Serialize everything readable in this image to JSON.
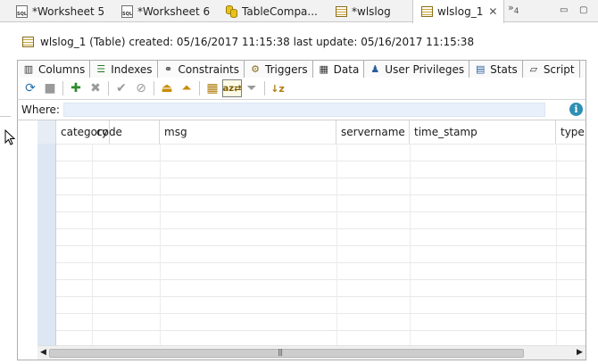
{
  "editor_tabs": [
    {
      "label": "*Worksheet 5",
      "icon": "sql-worksheet-icon"
    },
    {
      "label": "*Worksheet 6",
      "icon": "sql-worksheet-icon"
    },
    {
      "label": "TableCompa...",
      "icon": "table-compare-icon"
    },
    {
      "label": "*wlslog",
      "icon": "table-icon"
    },
    {
      "label": "wlslog_1",
      "icon": "table-icon",
      "active": true
    }
  ],
  "overflow_count": "4",
  "title": "wlslog_1 (Table) created: 05/16/2017 11:15:38 last update: 05/16/2017 11:15:38",
  "sub_tabs": [
    {
      "label": "Columns",
      "icon": "columns-icon"
    },
    {
      "label": "Indexes",
      "icon": "indexes-icon"
    },
    {
      "label": "Constraints",
      "icon": "constraints-icon"
    },
    {
      "label": "Triggers",
      "icon": "triggers-icon"
    },
    {
      "label": "Data",
      "icon": "data-grid-icon",
      "active": true
    },
    {
      "label": "User Privileges",
      "icon": "user-privileges-icon"
    },
    {
      "label": "Stats",
      "icon": "stats-icon"
    },
    {
      "label": "Script",
      "icon": "script-icon"
    }
  ],
  "toolbar": [
    "refresh-icon",
    "stop-icon",
    "add-row-icon",
    "delete-row-icon",
    "commit-icon",
    "rollback-icon",
    "export-icon",
    "import-icon",
    "grid-layout-icon",
    "sort-icon",
    "filter-icon",
    "sort-descending-icon"
  ],
  "where": {
    "label": "Where:",
    "value": ""
  },
  "grid": {
    "columns": [
      "category",
      "code",
      "msg",
      "servername",
      "time_stamp",
      "type"
    ],
    "rows": []
  },
  "colors": {
    "accent": "#2d8fb3",
    "where_input_bg": "#e8f1fb",
    "row_header_bg": "#dce7f3"
  }
}
